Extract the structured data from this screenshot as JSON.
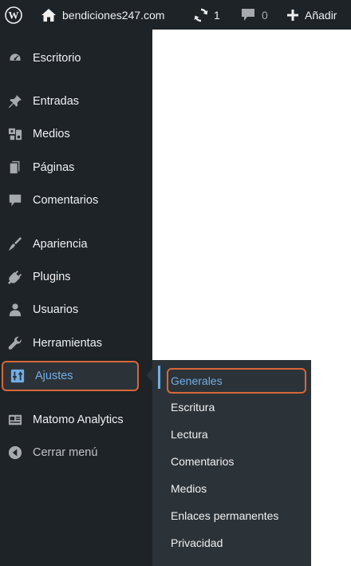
{
  "admin_bar": {
    "site_name": "bendiciones247.com",
    "updates_count": "1",
    "comments_count": "0",
    "new_label": "Añadir"
  },
  "sidebar": {
    "items": [
      {
        "label": "Escritorio",
        "icon": "dashboard-icon"
      },
      {
        "label": "Entradas",
        "icon": "pin-icon"
      },
      {
        "label": "Medios",
        "icon": "media-icon"
      },
      {
        "label": "Páginas",
        "icon": "pages-icon"
      },
      {
        "label": "Comentarios",
        "icon": "comment-icon"
      },
      {
        "label": "Apariencia",
        "icon": "paintbrush-icon"
      },
      {
        "label": "Plugins",
        "icon": "plugin-icon"
      },
      {
        "label": "Usuarios",
        "icon": "users-icon"
      },
      {
        "label": "Herramientas",
        "icon": "wrench-icon"
      },
      {
        "label": "Ajustes",
        "icon": "settings-icon",
        "current": true
      },
      {
        "label": "Matomo Analytics",
        "icon": "analytics-icon"
      },
      {
        "label": "Cerrar menú",
        "icon": "collapse-icon"
      }
    ]
  },
  "submenu": {
    "items": [
      {
        "label": "Generales",
        "current": true
      },
      {
        "label": "Escritura"
      },
      {
        "label": "Lectura"
      },
      {
        "label": "Comentarios"
      },
      {
        "label": "Medios"
      },
      {
        "label": "Enlaces permanentes"
      },
      {
        "label": "Privacidad"
      }
    ]
  },
  "colors": {
    "bar_background": "#1d2327",
    "submenu_background": "#2c3338",
    "accent": "#72aee6",
    "highlight_border": "#d6673a"
  }
}
